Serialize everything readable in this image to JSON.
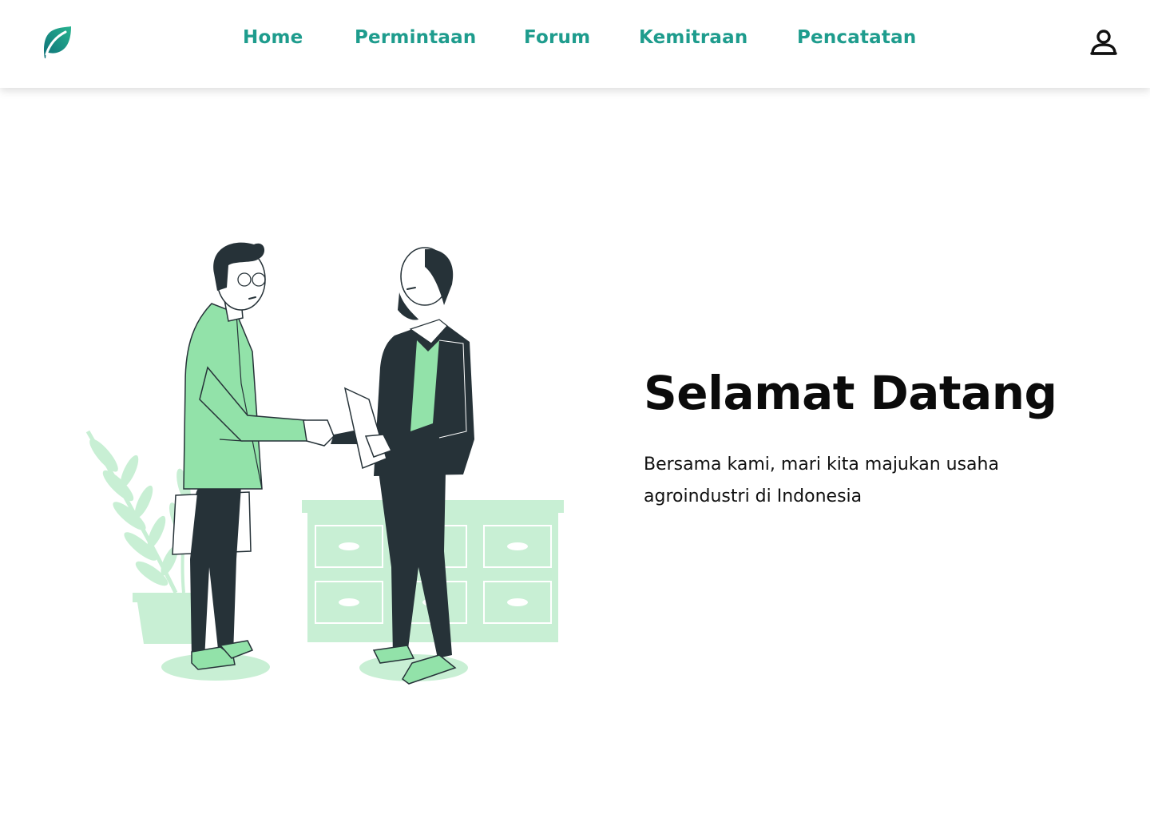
{
  "nav": {
    "logo_icon": "leaf-icon",
    "items": [
      {
        "label": "Home"
      },
      {
        "label": "Permintaan"
      },
      {
        "label": "Forum"
      },
      {
        "label": "Kemitraan"
      },
      {
        "label": "Pencatatan"
      }
    ],
    "profile_icon": "user-icon"
  },
  "hero": {
    "title": "Selamat Datang",
    "subtitle": "Bersama kami, mari kita majukan usaha agroindustri di Indonesia",
    "illustration": "two-men-handshake-illustration"
  },
  "colors": {
    "accent": "#1e9c8d",
    "green_light": "#c8efd4",
    "green_mid": "#92e2a9",
    "dark": "#263238"
  }
}
